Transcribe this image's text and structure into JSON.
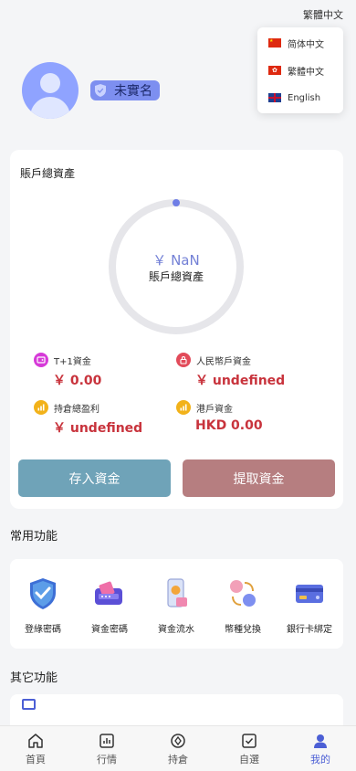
{
  "language": {
    "current": "繁體中文",
    "options": [
      {
        "label": "简体中文",
        "flag": "cn-flag"
      },
      {
        "label": "繁體中文",
        "flag": "hk-flag"
      },
      {
        "label": "English",
        "flag": "uk-flag"
      }
    ]
  },
  "profile": {
    "verification_status": "未實名"
  },
  "assets": {
    "title": "賬戶總資產",
    "total_value": "￥ NaN",
    "total_label": "賬戶總資產",
    "progress_fraction": 0,
    "stats": [
      {
        "label": "T+1資金",
        "value": "￥ 0.00",
        "icon": "wallet-icon",
        "color": "#d63ad8"
      },
      {
        "label": "人民幣戶資金",
        "value": "￥ undefined",
        "icon": "lock-icon",
        "color": "#e24b5a"
      },
      {
        "label": "持倉總盈利",
        "value": "￥ undefined",
        "icon": "profit-chart-icon",
        "color": "#f2b21a"
      },
      {
        "label": "港戶資金",
        "value": "HKD 0.00",
        "icon": "hk-account-icon",
        "color": "#f2b21a"
      }
    ],
    "deposit_label": "存入資金",
    "withdraw_label": "提取資金"
  },
  "common_functions": {
    "title": "常用功能",
    "items": [
      {
        "label": "登綠密碼",
        "icon": "shield-check-icon"
      },
      {
        "label": "資金密碼",
        "icon": "card-reader-icon"
      },
      {
        "label": "資金流水",
        "icon": "phone-money-icon"
      },
      {
        "label": "幣種兌換",
        "icon": "currency-exchange-icon"
      },
      {
        "label": "銀行卡綁定",
        "icon": "bank-card-icon"
      }
    ]
  },
  "other_functions": {
    "title": "其它功能"
  },
  "tabbar": {
    "items": [
      {
        "label": "首頁",
        "icon": "home-icon"
      },
      {
        "label": "行情",
        "icon": "market-chart-icon"
      },
      {
        "label": "持倉",
        "icon": "position-icon"
      },
      {
        "label": "自選",
        "icon": "watchlist-check-icon"
      },
      {
        "label": "我的",
        "icon": "user-icon",
        "active": true
      }
    ]
  },
  "colors": {
    "accent": "#4c5fd5",
    "deposit_button": "#6fa3b8",
    "withdraw_button": "#b67e80",
    "value_red": "#c8333c"
  }
}
